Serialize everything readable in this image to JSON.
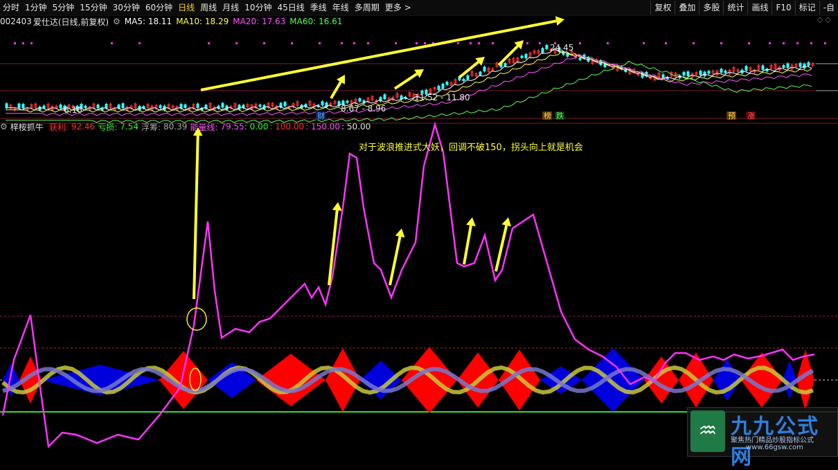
{
  "toolbar": {
    "periods": [
      "分时",
      "1分钟",
      "5分钟",
      "15分钟",
      "30分钟",
      "60分钟",
      "日线",
      "周线",
      "月线",
      "10分钟",
      "45日线",
      "季线",
      "年线",
      "多周期",
      "更多 >"
    ],
    "active_period": "日线",
    "buttons": [
      "复权",
      "叠加",
      "多股",
      "统计",
      "画线",
      "F10",
      "标记",
      "-自"
    ]
  },
  "stock": {
    "code": "002403",
    "name": "爱仕达",
    "mode": "(日线,前复权)",
    "ma5": "MA5: 18.11",
    "ma10": "MA10: 18.29",
    "ma20": "MA20: 17.63",
    "ma60": "MA60: 16.61",
    "corner": "◇ ◇"
  },
  "price_labels": {
    "high": "24.45",
    "low": "6.16",
    "range1": "11.52 - 11.80",
    "range2": "8.67 - 8.96",
    "tag_cai": "财",
    "tag_bang": "榜",
    "tag_die": "跌",
    "tag_yu": "预",
    "tag_zhang": "涨"
  },
  "indicator": {
    "name": "梓桉抓牛",
    "profit_label": "获利:",
    "profit": "92.46",
    "loss_label": "亏损:",
    "loss": "7.54",
    "float_label": "浮筹:",
    "float": "80.39",
    "energy_label": "能量线:",
    "energy": "79.55",
    "lvl0": ": 0.00",
    "lvl100": ": 100.00",
    "lvl150": ": 150.00",
    "lvl50": ": 50.00"
  },
  "annotation": "对于波浪推进式大妖，回调不破150，拐头向上就是机会",
  "watermark": {
    "title": "九九公式网",
    "subtitle": "聚焦热门精品炒股指标公式",
    "url": "www.66gsw.com"
  },
  "colors": {
    "up": "#ff3333",
    "down": "#33ffff",
    "energy": "#ff33ff",
    "arrow": "#ffff33",
    "red_band": "#ff0000",
    "blue_band": "#0000dd",
    "zero_line": "#33dd33"
  }
}
